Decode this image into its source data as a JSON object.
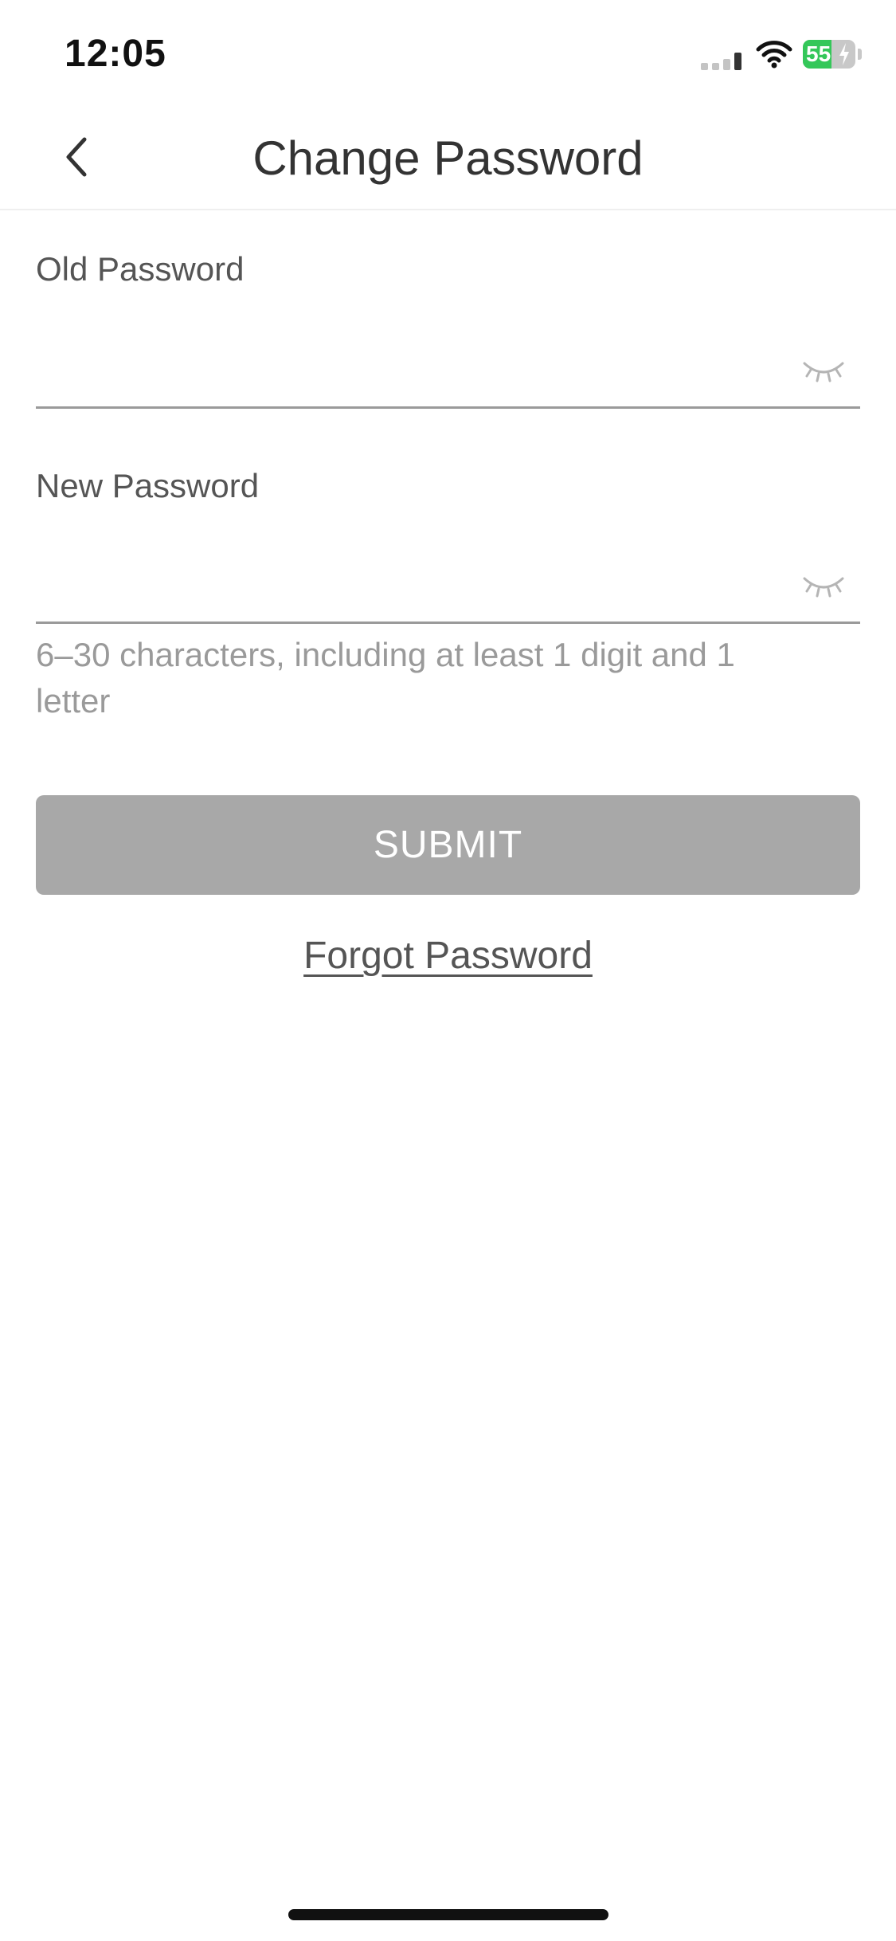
{
  "status_bar": {
    "time": "12:05",
    "battery_percent": "55",
    "battery_level": 0.55,
    "signal_bars_active": 1,
    "colors": {
      "battery_green": "#34c759"
    }
  },
  "nav": {
    "title": "Change Password",
    "back_icon": "chevron-left-icon"
  },
  "form": {
    "old_password": {
      "label": "Old Password",
      "value": "",
      "toggle_icon": "eye-closed-icon"
    },
    "new_password": {
      "label": "New Password",
      "value": "",
      "toggle_icon": "eye-closed-icon"
    },
    "hint": "6–30 characters, including at least 1 digit and 1 letter"
  },
  "actions": {
    "submit_label": "SUBMIT",
    "forgot_label": "Forgot Password"
  },
  "colors": {
    "submit_disabled": "#a8a8a8",
    "text_primary": "#333333",
    "text_hint": "#9a9a9a"
  }
}
